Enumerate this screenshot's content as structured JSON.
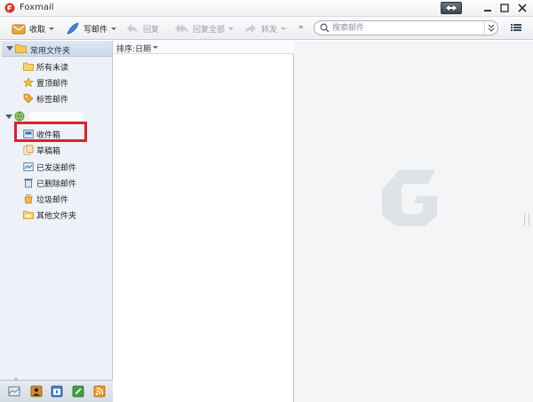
{
  "window": {
    "title": "Foxmail",
    "icons": {
      "logo": "foxmail-logo-icon",
      "restore": "restore-toggle-icon",
      "minimize": "minimize-icon",
      "maximize": "maximize-icon",
      "close": "close-icon"
    }
  },
  "toolbar": {
    "receive": {
      "label": "收取",
      "icon": "inbox-receive-icon"
    },
    "compose": {
      "label": "写邮件",
      "icon": "feather-pen-icon"
    },
    "reply": {
      "label": "回复",
      "icon": "reply-arrow-icon"
    },
    "reply_all": {
      "label": "回复全部",
      "icon": "reply-all-arrow-icon"
    },
    "forward": {
      "label": "转发",
      "icon": "forward-arrow-icon"
    },
    "more": "»",
    "search_placeholder": "搜索邮件"
  },
  "sidebar": {
    "common_folders": {
      "label": "常用文件夹",
      "items": [
        {
          "label": "所有未读",
          "icon": "folder-icon"
        },
        {
          "label": "置顶邮件",
          "icon": "star-icon"
        },
        {
          "label": "标签邮件",
          "icon": "tag-icon"
        }
      ]
    },
    "account_folders": [
      {
        "label": "收件箱",
        "icon": "inbox-icon"
      },
      {
        "label": "草稿箱",
        "icon": "drafts-icon"
      },
      {
        "label": "已发送邮件",
        "icon": "sent-icon"
      },
      {
        "label": "已删除邮件",
        "icon": "trash-icon"
      },
      {
        "label": "垃圾邮件",
        "icon": "spam-icon"
      },
      {
        "label": "其他文件夹",
        "icon": "folder-icon"
      }
    ],
    "bottom_tabs": [
      "mail-tab-icon",
      "contacts-tab-icon",
      "calendar-tab-icon",
      "notes-tab-icon",
      "rss-tab-icon"
    ]
  },
  "maillist": {
    "sort_label": "排序:日期"
  },
  "colors": {
    "highlight": "#e0202a",
    "sidebar_bg": "#eef2f8",
    "reading_bg": "#f4f5f7"
  }
}
